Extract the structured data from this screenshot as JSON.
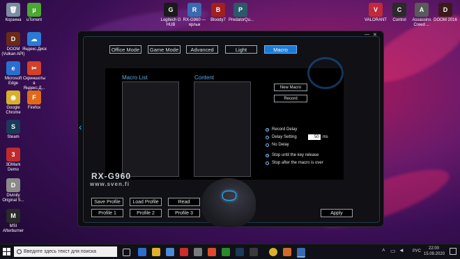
{
  "desktop": {
    "left_icons": [
      {
        "label": "Корзина",
        "glyph": "🗑",
        "color": "#7a8ea0",
        "icon": "recycle-bin-icon"
      },
      {
        "label": "uTorrent",
        "glyph": "µ",
        "color": "#4aa832",
        "icon": "utorrent-icon"
      },
      {
        "label": "DOOM (Vulkan API)",
        "glyph": "D",
        "color": "#6a2a1a",
        "icon": "doom-icon"
      },
      {
        "label": "Яндекс.Диск",
        "glyph": "☁",
        "color": "#2a7ad6",
        "icon": "yandex-disk-icon"
      },
      {
        "label": "Microsoft Edge",
        "glyph": "e",
        "color": "#2a6fd0",
        "icon": "edge-icon"
      },
      {
        "label": "Скриншоты в Яндекс.Д...",
        "glyph": "✂",
        "color": "#d0402a",
        "icon": "screenshot-icon"
      },
      {
        "label": "Google Chrome",
        "glyph": "◉",
        "color": "#d8b02a",
        "icon": "chrome-icon"
      },
      {
        "label": "Firefox",
        "glyph": "🦊",
        "color": "#e06a1a",
        "icon": "firefox-icon"
      },
      {
        "label": "Steam",
        "glyph": "S",
        "color": "#1a3a5a",
        "icon": "steam-icon"
      },
      {
        "label": "3DMark Demo",
        "glyph": "3",
        "color": "#c02a2a",
        "icon": "3dmark-icon"
      },
      {
        "label": "Divinity Original S...",
        "glyph": "D",
        "color": "#8a8a8a",
        "icon": "divinity-icon"
      },
      {
        "label": "MSI Afterburner",
        "glyph": "M",
        "color": "#2a2a2a",
        "icon": "msi-afterburner-icon"
      }
    ],
    "top_icons": [
      {
        "label": "Logitech G HUB",
        "glyph": "G",
        "color": "#1a1a1a",
        "icon": "logitech-icon"
      },
      {
        "label": "RX-G960 — ярлык",
        "glyph": "R",
        "color": "#3a6ab0",
        "icon": "rx-g960-icon"
      },
      {
        "label": "Bloody7",
        "glyph": "B",
        "color": "#a02020",
        "icon": "bloody7-icon"
      },
      {
        "label": "PredatorQu...",
        "glyph": "P",
        "color": "#2a5a6a",
        "icon": "predator-icon"
      }
    ],
    "right_icons": [
      {
        "label": "VALORANT",
        "glyph": "V",
        "color": "#c02a3a",
        "icon": "valorant-icon"
      },
      {
        "label": "Control",
        "glyph": "C",
        "color": "#2a2a2a",
        "icon": "control-icon"
      },
      {
        "label": "Assassins Creed ...",
        "glyph": "A",
        "color": "#5a5a5a",
        "icon": "assassins-creed-icon"
      },
      {
        "label": "DOOM 2016",
        "glyph": "D",
        "color": "#3a1a1a",
        "icon": "doom-2016-icon"
      }
    ]
  },
  "app": {
    "close_glyph": "✕",
    "minimize_glyph": "—",
    "tabs": [
      "Office Mode",
      "Game Mode",
      "Advanced",
      "Light",
      "Macro"
    ],
    "active_tab": "Macro",
    "macro_list_heading": "Macro List",
    "content_heading": "Content",
    "new_macro_label": "New Macro",
    "record_label": "Record",
    "options": {
      "record_delay": "Record Delay",
      "delay_setting": "Delay Setting",
      "delay_value": "50",
      "delay_unit": "ms",
      "no_delay": "No Delay",
      "stop_release": "Stop until the key release",
      "stop_after": "Stop after the macro is over"
    },
    "brand_model": "RX-G960",
    "brand_site": "www.sven.fi",
    "save_profile": "Save Profile",
    "load_profile": "Load Profile",
    "read": "Read",
    "profile_1": "Profile 1",
    "profile_2": "Profile 2",
    "profile_3": "Profile 3",
    "apply": "Apply"
  },
  "taskbar": {
    "search_placeholder": "Введите здесь текст для поиска",
    "lang": "РУС",
    "time": "22:00",
    "date": "15.09.2020"
  }
}
